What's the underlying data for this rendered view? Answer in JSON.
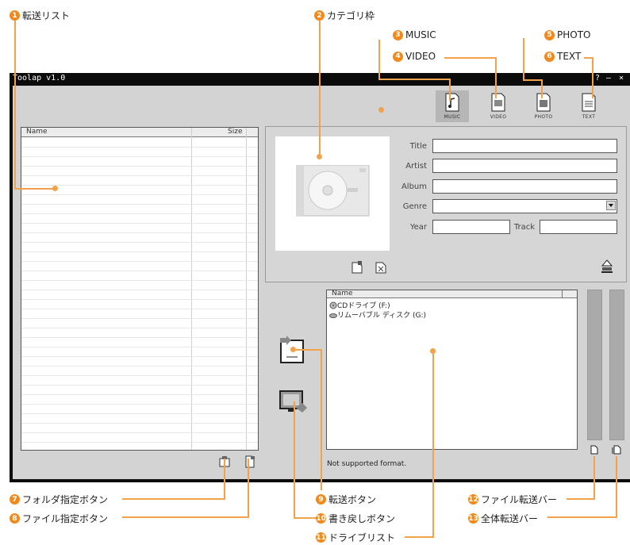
{
  "annotations": {
    "a1": {
      "num": "1",
      "label": "転送リスト"
    },
    "a2": {
      "num": "2",
      "label": "カテゴリ枠"
    },
    "a3": {
      "num": "3",
      "label": "MUSIC"
    },
    "a4": {
      "num": "4",
      "label": "VIDEO"
    },
    "a5": {
      "num": "5",
      "label": "PHOTO"
    },
    "a6": {
      "num": "6",
      "label": "TEXT"
    },
    "a7": {
      "num": "7",
      "label": "フォルダ指定ボタン"
    },
    "a8": {
      "num": "8",
      "label": "ファイル指定ボタン"
    },
    "a9": {
      "num": "9",
      "label": "転送ボタン"
    },
    "a10": {
      "num": "10",
      "label": "書き戻しボタン"
    },
    "a11": {
      "num": "11",
      "label": "ドライブリスト"
    },
    "a12": {
      "num": "12",
      "label": "ファイル転送バー"
    },
    "a13": {
      "num": "13",
      "label": "全体転送バー"
    }
  },
  "window": {
    "title": "Toolap v1.0",
    "help": "?",
    "minimize": "–",
    "close": "×"
  },
  "file_list": {
    "col_name": "Name",
    "col_size": "Size"
  },
  "categories": {
    "music": "MUSIC",
    "video": "VIDEO",
    "photo": "PHOTO",
    "text": "TEXT"
  },
  "fields": {
    "title": "Title",
    "artist": "Artist",
    "album": "Album",
    "genre": "Genre",
    "year": "Year",
    "track": "Track"
  },
  "drive_list": {
    "col_name": "Name",
    "items": [
      "CDドライブ (F:)",
      "リムーバブル ディスク (G:)"
    ]
  },
  "status": "Not supported format.",
  "colors": {
    "accent": "#f08a1c",
    "leader": "#f2a24a"
  }
}
